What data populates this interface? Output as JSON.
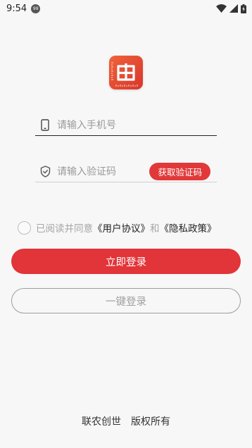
{
  "status_bar": {
    "time": "9:54",
    "notification_icon_text": "99"
  },
  "form": {
    "phone_placeholder": "请输入手机号",
    "code_placeholder": "请输入验证码",
    "get_code_label": "获取验证码"
  },
  "agreement": {
    "prefix": "已阅读并同意",
    "user_agreement": "《用户协议》",
    "and": "和",
    "privacy_policy": "《隐私政策》"
  },
  "buttons": {
    "login_label": "立即登录",
    "one_key_login_label": "一键登录"
  },
  "footer": {
    "company": "联农创世",
    "rights": "版权所有"
  },
  "colors": {
    "accent": "#e1393a",
    "background": "#f7f7f7"
  },
  "icons": {
    "phone_field": "phone-icon",
    "code_field": "shield-check-icon",
    "logo": "app-logo"
  }
}
